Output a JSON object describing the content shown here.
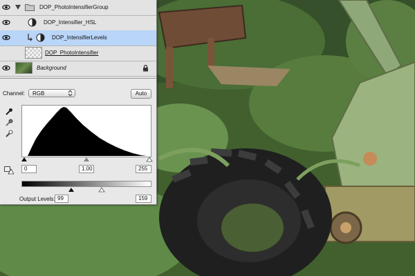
{
  "layers": [
    {
      "name": "DOP_PhotoIntensifierGroup",
      "type": "group"
    },
    {
      "name": "DOP_Intensifier_HSL",
      "type": "adjustment"
    },
    {
      "name": "DOP_IntensifierLevels",
      "type": "adjustment",
      "selected": true
    },
    {
      "name": "DOP_PhotoIntensifier",
      "type": "layer"
    },
    {
      "name": "Background",
      "type": "background",
      "locked": true
    }
  ],
  "levels": {
    "channel_label": "Channel:",
    "channel_value": "RGB",
    "auto_label": "Auto",
    "input_black": "0",
    "input_gamma": "1.00",
    "input_white": "255",
    "output_label": "Output Levels:",
    "output_black": "99",
    "output_white": "159"
  },
  "icons": [
    "eye-icon",
    "folder-icon",
    "disclosure-triangle-icon",
    "adjustment-layer-icon",
    "clip-arrow-icon",
    "lock-icon",
    "eyedropper-black-icon",
    "eyedropper-gray-icon",
    "eyedropper-white-icon",
    "warning-icon"
  ]
}
